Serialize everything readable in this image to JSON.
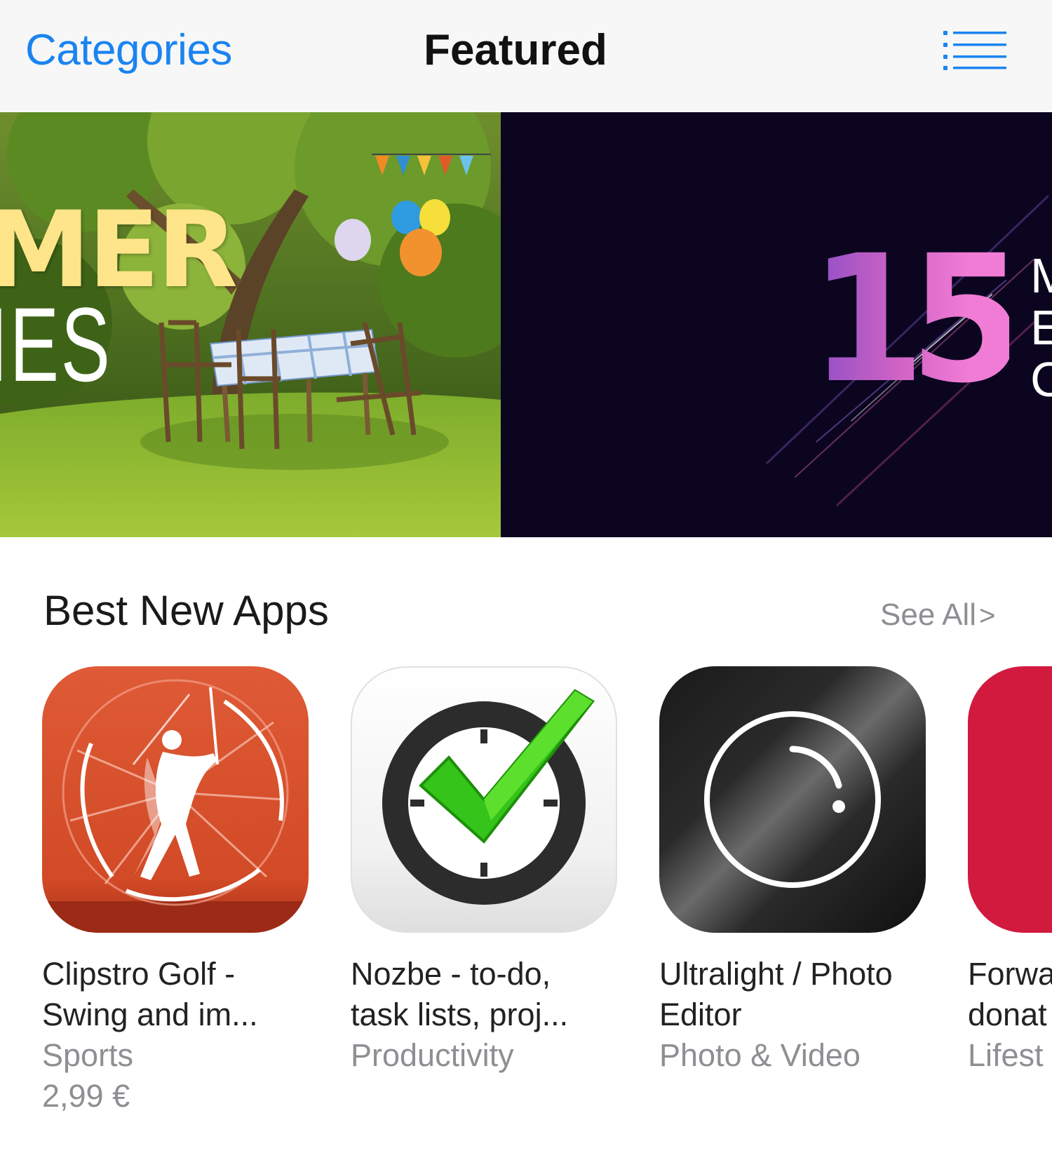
{
  "navbar": {
    "left_label": "Categories",
    "title": "Featured",
    "right_icon": "list-icon"
  },
  "banners": [
    {
      "name": "summer-parties-banner",
      "text_line1": "MER",
      "text_line2": "IES"
    },
    {
      "name": "fifteen-banner",
      "big_number": "15",
      "side_letters": [
        "M",
        "E",
        "C"
      ]
    }
  ],
  "section": {
    "title": "Best New Apps",
    "see_all": "See All",
    "see_all_chevron": ">"
  },
  "apps": [
    {
      "name_line1": "Clipstro Golf -",
      "name_line2": "Swing and im...",
      "category": "Sports",
      "price": "2,99 €",
      "icon": "golfer-icon"
    },
    {
      "name_line1": "Nozbe - to-do,",
      "name_line2": "task lists, proj...",
      "category": "Productivity",
      "price": "",
      "icon": "clock-check-icon"
    },
    {
      "name_line1": "Ultralight / Photo",
      "name_line2": "Editor",
      "category": "Photo & Video",
      "price": "",
      "icon": "camera-lens-icon"
    },
    {
      "name_line1": "Forwa",
      "name_line2": "donat",
      "category": "Lifest",
      "price": "",
      "icon": "red-app-icon"
    }
  ],
  "colors": {
    "accent": "#1a84f0",
    "secondary_text": "#8e8e93",
    "clipstro": "#d94e2b",
    "partial_app": "#d11a3e"
  }
}
